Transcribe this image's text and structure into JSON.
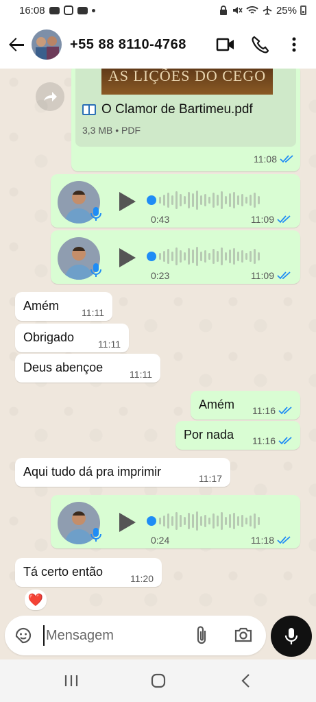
{
  "status_bar": {
    "time": "16:08",
    "battery": "25%"
  },
  "header": {
    "contact": "+55 88 8110-4768"
  },
  "pdf_message": {
    "cover_text": "AS LIÇÕES DO CEGO",
    "file_name": "O Clamor de Bartimeu.pdf",
    "meta": "3,3 MB • PDF",
    "time": "11:08"
  },
  "voice_messages": [
    {
      "duration": "0:43",
      "time": "11:09"
    },
    {
      "duration": "0:23",
      "time": "11:09"
    },
    {
      "duration": "0:24",
      "time": "11:18"
    }
  ],
  "messages": [
    {
      "dir": "in",
      "text": "Amém",
      "time": "11:11"
    },
    {
      "dir": "in",
      "text": "Obrigado",
      "time": "11:11"
    },
    {
      "dir": "in",
      "text": "Deus abençoe",
      "time": "11:11"
    },
    {
      "dir": "out",
      "text": "Amém",
      "time": "11:16"
    },
    {
      "dir": "out",
      "text": "Por nada",
      "time": "11:16"
    },
    {
      "dir": "in",
      "text": "Aqui tudo dá pra imprimir",
      "time": "11:17"
    },
    {
      "dir": "in",
      "text": "Tá certo então",
      "time": "11:20"
    }
  ],
  "reaction": "❤️",
  "composer": {
    "placeholder": "Mensagem"
  },
  "colors": {
    "outgoing": "#d9fdd3",
    "incoming": "#ffffff",
    "read_ticks": "#1f8cf5"
  }
}
